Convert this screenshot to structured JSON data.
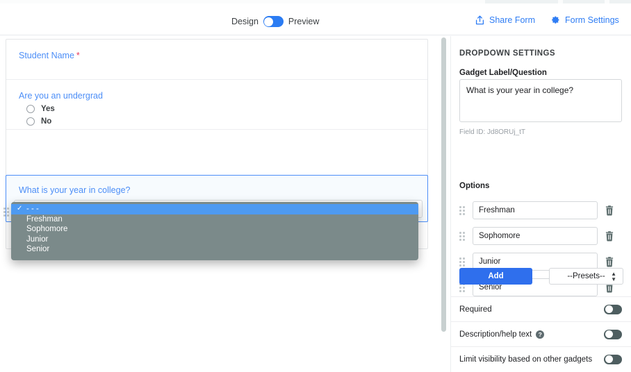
{
  "toolbar": {
    "design_label": "Design",
    "preview_label": "Preview",
    "toggle_state": "design",
    "share_label": "Share Form",
    "share_icon": "share-upload-icon",
    "settings_label": "Form Settings",
    "settings_icon": "gear-icon",
    "accent_color": "#2f7df4"
  },
  "form": {
    "fields": [
      {
        "label": "Student Name",
        "required": true,
        "type": "text"
      },
      {
        "label": "Are you an undergrad",
        "required": false,
        "type": "radio",
        "options": [
          "Yes",
          "No"
        ]
      },
      {
        "label": "What is your year in college?",
        "required": false,
        "type": "dropdown",
        "selected": true
      }
    ],
    "label_color": "#4c8ef7",
    "required_marker": "*",
    "required_color": "#e8395b"
  },
  "dropdown_popup": {
    "open": true,
    "selected_index": 0,
    "items": [
      "- - -",
      "Freshman",
      "Sophomore",
      "Junior",
      "Senior"
    ],
    "highlight_color": "#4e9af1",
    "background_color": "#7b8a8a"
  },
  "settings_panel": {
    "title": "DROPDOWN SETTINGS",
    "gadget_label_heading": "Gadget Label/Question",
    "gadget_label_value": "What is your year in college?",
    "field_id_text": "Field ID: Jd8ORUj_tT",
    "options_heading": "Options",
    "options": [
      "Freshman",
      "Sophomore",
      "Junior",
      "Senior"
    ],
    "delete_icon": "trash-icon",
    "drag_icon": "drag-handle-icon",
    "add_label": "Add",
    "add_color": "#2f6fed",
    "presets_value": "--Presets--",
    "toggles": [
      {
        "label": "Required",
        "state": "off",
        "has_help": false
      },
      {
        "label": "Description/help text",
        "state": "off",
        "has_help": true,
        "help_icon": "question-mark-icon"
      },
      {
        "label": "Limit visibility based on other gadgets",
        "state": "off",
        "has_help": false
      }
    ],
    "toggle_off_color": "#4e5e60"
  }
}
